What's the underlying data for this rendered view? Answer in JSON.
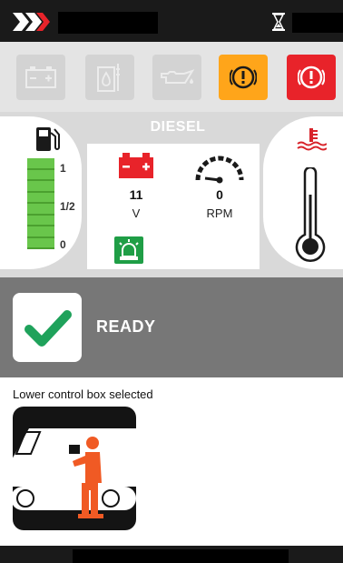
{
  "engine": {
    "fuel_type": "DIESEL",
    "fuel_level_fraction": 1.0,
    "fuel_scale": {
      "full": "1",
      "half": "1/2",
      "empty": "0"
    },
    "battery": {
      "value": "11",
      "unit": "V"
    },
    "engine_speed": {
      "value": "0",
      "unit": "RPM"
    }
  },
  "alerts": {
    "icons": [
      "battery-icon",
      "hydraulic-fluid-icon",
      "oil-pressure-icon",
      "warning-icon",
      "fault-icon"
    ],
    "colors": {
      "amber": "#ffa51a",
      "red": "#e8232a",
      "inactive": "#d3d3d3"
    }
  },
  "status": {
    "label": "READY",
    "icon": "checkmark-icon",
    "color": "#1fa25b"
  },
  "control": {
    "label": "Lower control box selected"
  },
  "colors": {
    "fuel_green": "#69c64b",
    "battery_red": "#e8232a",
    "beacon_green": "#1f9e46",
    "temperature_red": "#d8232a",
    "operator_orange": "#f05a24"
  }
}
